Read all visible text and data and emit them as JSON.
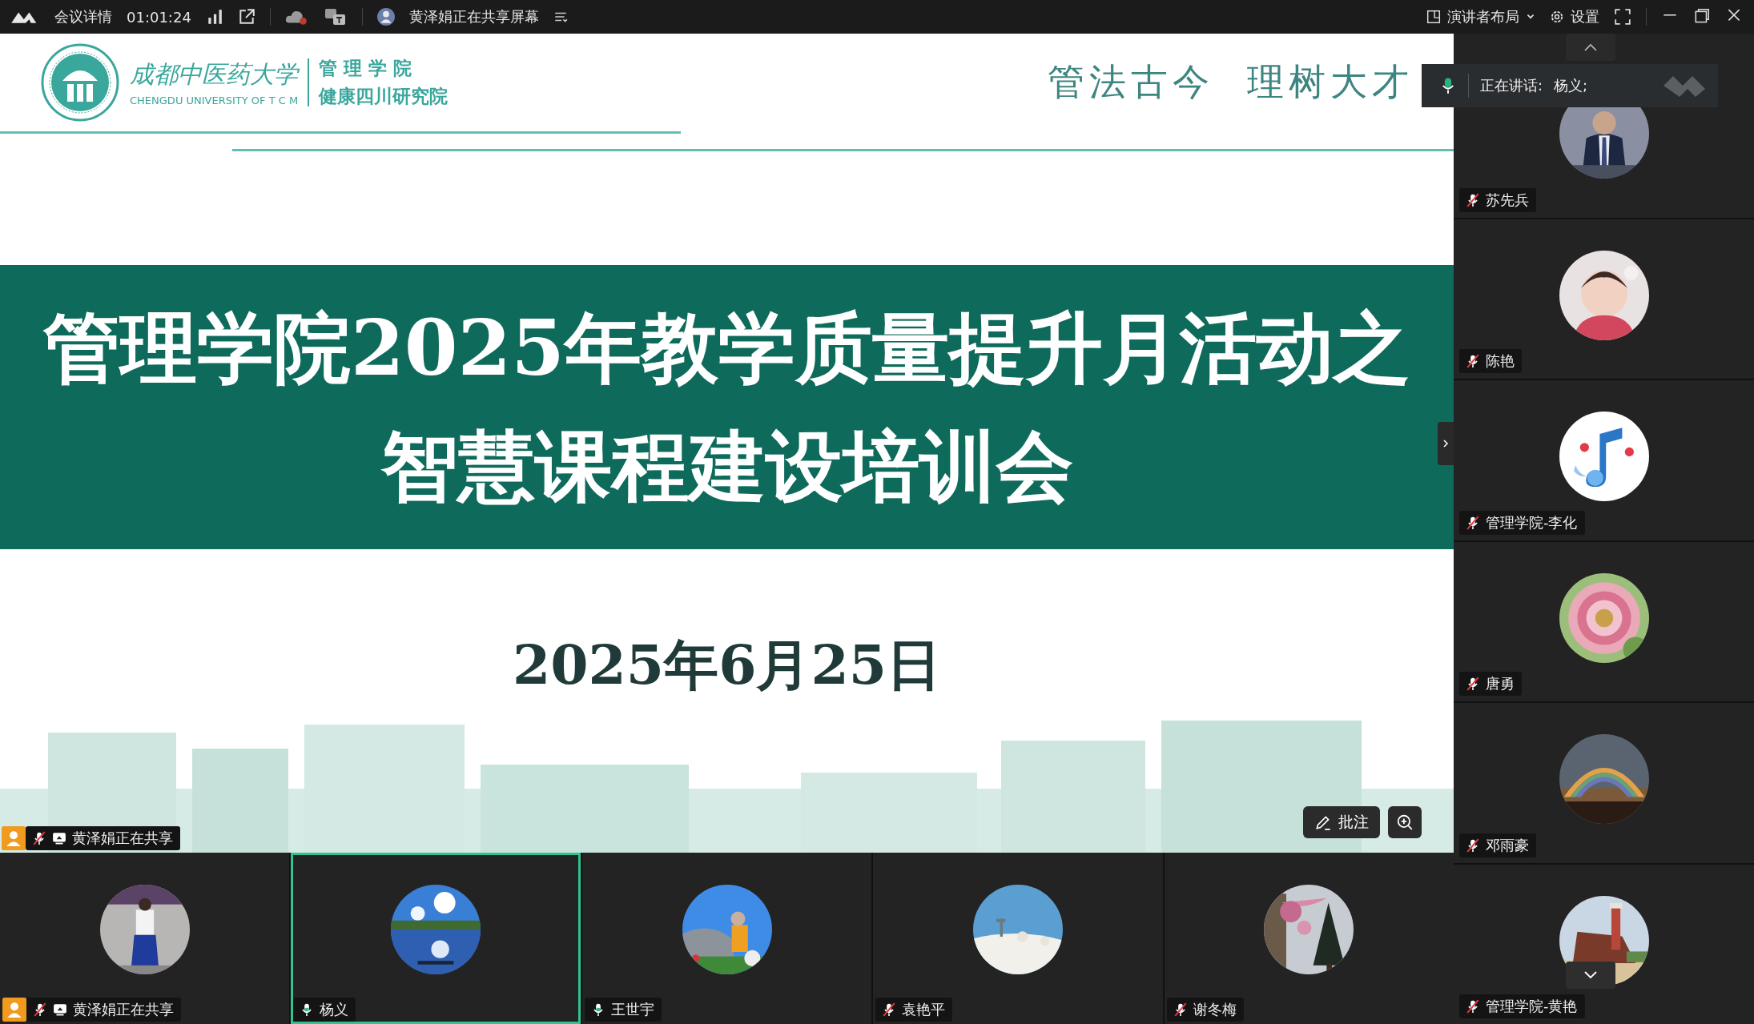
{
  "top_bar": {
    "meeting_info": "会议详情",
    "duration": "01:01:24",
    "sharing_status": "黄泽娟正在共享屏幕",
    "layout": "演讲者布局",
    "settings": "设置"
  },
  "slide": {
    "university_name": "成都中医药大学",
    "university_name_en": "CHENGDU UNIVERSITY OF T C M",
    "school": "管 理 学 院",
    "institute": "健康四川研究院",
    "motto": "管法古今  理树大才",
    "title_lines": [
      "管理学院2025年教学质量提升月活动之",
      "智慧课程建设培训会"
    ],
    "date": "2025年6月25日"
  },
  "sharing_badge": {
    "label": "黄泽娟正在共享",
    "host": true,
    "muted": true,
    "sharing": true
  },
  "annotate_button": "批注",
  "speaking_banner": {
    "label": "正在讲话:",
    "speaker": "杨义;"
  },
  "right_panel": {
    "participants": [
      {
        "name": "苏先兵",
        "muted": true,
        "host": false,
        "sharing": false,
        "selected": false
      },
      {
        "name": "陈艳",
        "muted": true,
        "host": false,
        "sharing": false,
        "selected": false
      },
      {
        "name": "管理学院-李化",
        "muted": true,
        "host": false,
        "sharing": false,
        "selected": false
      },
      {
        "name": "唐勇",
        "muted": true,
        "host": false,
        "sharing": false,
        "selected": false
      },
      {
        "name": "邓雨豪",
        "muted": true,
        "host": false,
        "sharing": false,
        "selected": false
      },
      {
        "name": "管理学院-黄艳",
        "muted": true,
        "host": false,
        "sharing": false,
        "selected": false
      }
    ]
  },
  "bottom_strip": {
    "participants": [
      {
        "name": "黄泽娟正在共享",
        "muted": true,
        "host": true,
        "sharing": true,
        "selected": false
      },
      {
        "name": "杨义",
        "muted": false,
        "host": false,
        "sharing": false,
        "selected": true
      },
      {
        "name": "王世宇",
        "muted": false,
        "host": false,
        "sharing": false,
        "selected": false
      },
      {
        "name": "袁艳平",
        "muted": true,
        "host": false,
        "sharing": false,
        "selected": false
      },
      {
        "name": "谢冬梅",
        "muted": true,
        "host": false,
        "sharing": false,
        "selected": false
      }
    ]
  }
}
